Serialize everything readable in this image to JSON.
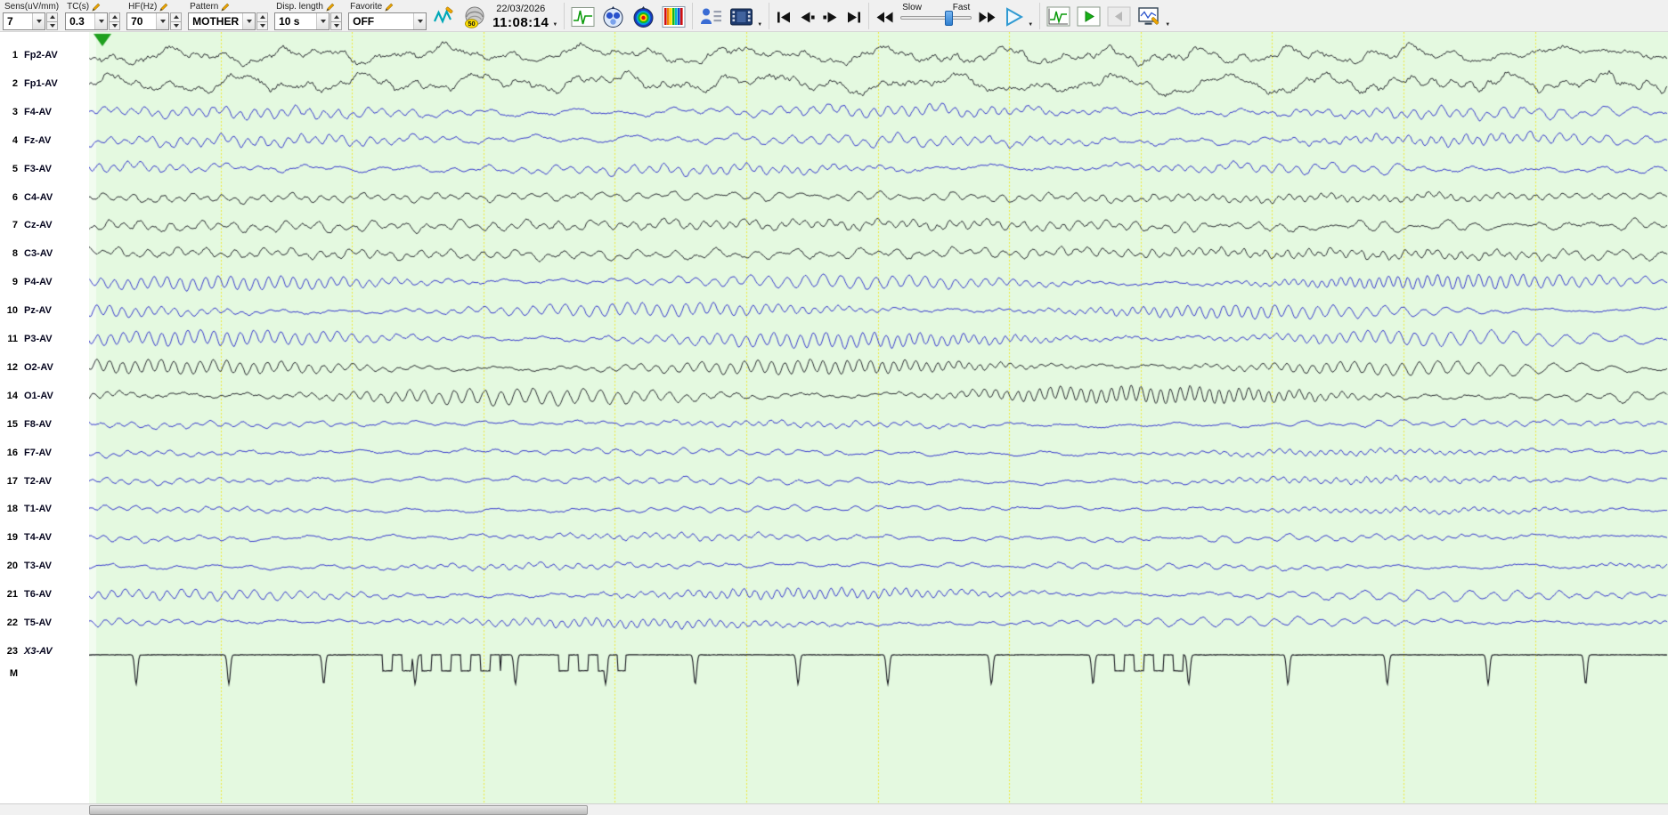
{
  "toolbar": {
    "sens": {
      "label": "Sens(uV/mm)",
      "value": "7"
    },
    "tc": {
      "label": "TC(s)",
      "value": "0.3"
    },
    "hf": {
      "label": "HF(Hz)",
      "value": "70"
    },
    "pattern": {
      "label": "Pattern",
      "value": "MOTHER"
    },
    "disp_length": {
      "label": "Disp. length",
      "value": "10 s"
    },
    "favorite": {
      "label": "Favorite",
      "value": "OFF"
    },
    "notch_badge": "50",
    "date": "22/03/2026",
    "time": "11:08:14",
    "speed": {
      "slow_label": "Slow",
      "fast_label": "Fast"
    }
  },
  "channels": [
    {
      "num": "1",
      "label": "Fp2-AV",
      "color": "black",
      "wave": "frontal"
    },
    {
      "num": "2",
      "label": "Fp1-AV",
      "color": "black",
      "wave": "frontal"
    },
    {
      "num": "3",
      "label": "F4-AV",
      "color": "blue",
      "wave": "alpha-med"
    },
    {
      "num": "4",
      "label": "Fz-AV",
      "color": "blue",
      "wave": "alpha-med"
    },
    {
      "num": "5",
      "label": "F3-AV",
      "color": "blue",
      "wave": "alpha-med"
    },
    {
      "num": "6",
      "label": "C4-AV",
      "color": "black",
      "wave": "central"
    },
    {
      "num": "7",
      "label": "Cz-AV",
      "color": "black",
      "wave": "central"
    },
    {
      "num": "8",
      "label": "C3-AV",
      "color": "black",
      "wave": "central"
    },
    {
      "num": "9",
      "label": "P4-AV",
      "color": "blue",
      "wave": "alpha-strong"
    },
    {
      "num": "10",
      "label": "Pz-AV",
      "color": "blue",
      "wave": "alpha-strong"
    },
    {
      "num": "11",
      "label": "P3-AV",
      "color": "blue",
      "wave": "alpha-strong"
    },
    {
      "num": "12",
      "label": "O2-AV",
      "color": "black",
      "wave": "alpha-strong"
    },
    {
      "num": "14",
      "label": "O1-AV",
      "color": "black",
      "wave": "alpha-strong"
    },
    {
      "num": "15",
      "label": "F8-AV",
      "color": "blue",
      "wave": "temporal-low"
    },
    {
      "num": "16",
      "label": "F7-AV",
      "color": "blue",
      "wave": "temporal-low"
    },
    {
      "num": "17",
      "label": "T2-AV",
      "color": "blue",
      "wave": "temporal-low"
    },
    {
      "num": "18",
      "label": "T1-AV",
      "color": "blue",
      "wave": "temporal-low"
    },
    {
      "num": "19",
      "label": "T4-AV",
      "color": "blue",
      "wave": "temporal-low"
    },
    {
      "num": "20",
      "label": "T3-AV",
      "color": "blue",
      "wave": "temporal-low"
    },
    {
      "num": "21",
      "label": "T6-AV",
      "color": "blue",
      "wave": "temporal-alpha"
    },
    {
      "num": "22",
      "label": "T5-AV",
      "color": "blue",
      "wave": "temporal-alpha"
    },
    {
      "num": "23",
      "label": "X3-AV",
      "color": "black",
      "wave": "ecg",
      "italic": true
    }
  ],
  "marker_row_label": "M",
  "colors": {
    "paper_bg": "#e4f9e0",
    "grid_yellow": "#eeea3c",
    "trace_blue": "#2323cb",
    "trace_black": "#15151d",
    "marker_green": "#1fa01f"
  }
}
